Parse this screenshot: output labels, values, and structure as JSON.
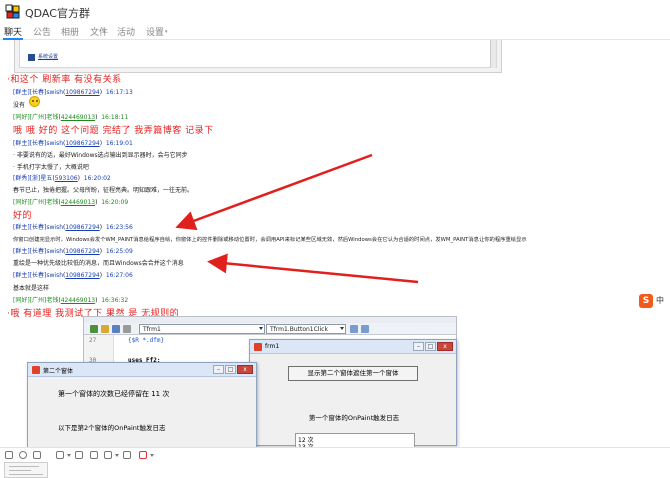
{
  "app": {
    "title": "QDAC官方群"
  },
  "tabs": [
    {
      "label": "聊天",
      "active": true
    },
    {
      "label": "公告"
    },
    {
      "label": "相册"
    },
    {
      "label": "文件"
    },
    {
      "label": "活动"
    },
    {
      "label": "设置"
    }
  ],
  "embed_top": {
    "link_text": "系统设置"
  },
  "chat": {
    "m1_text": "·和这个 刷新率 有没有关系",
    "m2": {
      "tag": "[群主]",
      "name": "[长春]swish",
      "uid": "109867294",
      "time": "16:17:13",
      "text": "没有"
    },
    "m3": {
      "tag": "[同好]",
      "name": "[广州]老钱",
      "uid": "424469013",
      "time": "16:18:11"
    },
    "m3_text": "哦 哦 好的 这个问题 完结了 我弄篇博客 记录下",
    "m4": {
      "tag": "[群主]",
      "name": "[长春]swish",
      "uid": "109867294",
      "time": "16:19:01",
      "text1": "· 非要说有的话，最好Windows选点输出到显示器时，会与它同步",
      "text2": "· 手机打字太慢了，大概说吧"
    },
    "m5": {
      "tag": "[群秀]",
      "name": "[浙]星五",
      "uid": "593106",
      "time": "16:20:02",
      "text": "春节已止，独倦把握。父母所盼，征程亮典。明知跟难，一往无前。"
    },
    "m6": {
      "tag": "[同好]",
      "name": "[广州]老钱",
      "uid": "424469013",
      "time": "16:20:09"
    },
    "m6_text": "好的",
    "m7": {
      "tag": "[群主]",
      "name": "[长春]swish",
      "uid": "109867294",
      "time": "16:23:56",
      "text": "你窗口创建完显示时，Windows会发个WM_PAINT消息给程序自绘，你窗体上的控件删除或移动位置时，会调用API来标记某些区域无效，然后Windows会在它认为合适的时间点，发WM_PAINT消息让你的程序重绘显示"
    },
    "m8": {
      "tag": "[群主]",
      "name": "[长春]swish",
      "uid": "109867294",
      "time": "16:25:09",
      "text": "重绘是一种优先级比较低的消息，而且Windows会合并这个消息"
    },
    "m9": {
      "tag": "[群主]",
      "name": "[长春]swish",
      "uid": "109867294",
      "time": "16:27:06",
      "text": "基本就是这样"
    },
    "m10": {
      "tag": "[同好]",
      "name": "[广州]老钱",
      "uid": "424469013",
      "time": "16:36:32"
    },
    "m10_text": "·哦 有道理 我测试了下 果然 是 无规则的"
  },
  "ide": {
    "combo_form": "Tfrm1",
    "combo_method": "Tfrm1.Button1Click",
    "line_numbers": [
      "27",
      "",
      "30",
      ""
    ],
    "code_lines": [
      "{$R *.dfm}",
      "",
      "uses Ff2;",
      ""
    ]
  },
  "win1": {
    "title": "frm1",
    "button": "显示第二个窗体遮住第一个窗体",
    "label": "第一个窗体的OnPaint触发日志",
    "list": [
      "12 次",
      "13 次"
    ]
  },
  "win2": {
    "title": "第二个窗体",
    "line1": "第一个窗体的次数已经停留在 11 次",
    "line2": "以下是第2个窗体的OnPaint触发日志"
  },
  "ime": {
    "logo": "S",
    "text": "中"
  },
  "window_buttons": {
    "minimize": "–",
    "maximize": "□",
    "close": "x"
  },
  "colors": {
    "accent": "#1e87f0",
    "highlight_red": "#e8201f",
    "owner_blue": "#1a3fb5",
    "member_green": "#1c8a1c",
    "arrow_red": "#e0201d"
  }
}
